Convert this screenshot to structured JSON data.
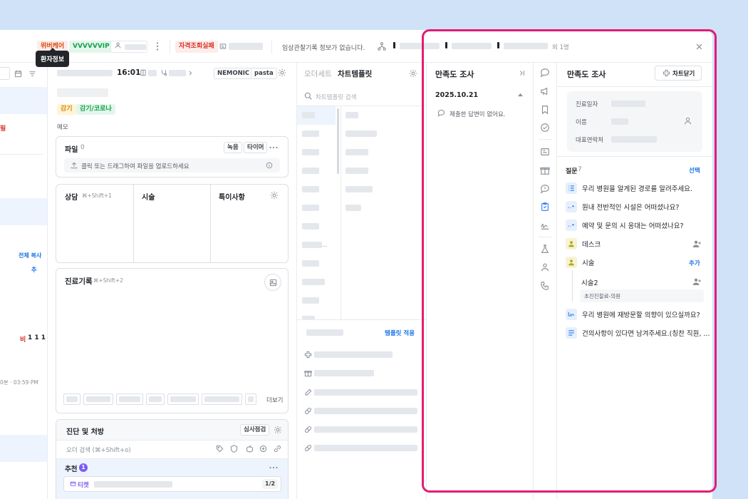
{
  "topbar": {
    "tag_care": "위버케어",
    "tag_vip": "VVVVVVIP",
    "tooltip": "환자정보",
    "tag_eligibility": "자격조회실패",
    "clinical_notice": "임상관찰기록 정보가 없습니다.",
    "extra_count": "외 1명"
  },
  "chart": {
    "time": "16:01",
    "tags": [
      "감기",
      "감기/코로나"
    ],
    "memo_label": "메모",
    "file_label": "파일",
    "file_count": "0",
    "btn_record": "녹음",
    "btn_timer": "타이머",
    "upload_hint": "클릭 또는 드래그하여 파일을 업로드하세요",
    "consult_label": "상담",
    "consult_shortcut": "⌘+Shift+1",
    "treatment_label": "시술",
    "special_label": "특이사항",
    "record_label": "진료기록",
    "record_shortcut": "⌘+Shift+2",
    "more_label": "더보기",
    "diagnosis_label": "진단 및 처방",
    "btn_audit": "심사점검",
    "order_search": "오더 검색 (⌘+Shift+o)",
    "recommend_label": "추천",
    "recommend_count": "1",
    "ticket_label": "티켓",
    "ticket_page": "1/2"
  },
  "left_col": {
    "copy_all": "전체 복사",
    "add": "추",
    "amount": "1 1 1",
    "non_label": "비",
    "time_range": "0분 · 03:59 PM",
    "red_text": "필"
  },
  "template": {
    "tab_orderset": "오더세트",
    "tab_chart": "차트템플릿",
    "search_placeholder": "차트템플릿 검색",
    "apply": "템플릿 적용",
    "dots": "..."
  },
  "badges": {
    "nemonic": "NEMONIC",
    "pasta": "pasta"
  },
  "survey_list": {
    "title": "만족도 조사",
    "date": "2025.10.21",
    "empty": "제출한 답변이 없어요."
  },
  "survey_detail": {
    "title": "만족도 조사",
    "close_chart": "차트닫기",
    "field_date": "진료일자",
    "field_name": "이름",
    "field_phone": "대표연락처",
    "questions_label": "질문",
    "questions_count": "7",
    "select": "선택",
    "add": "추가",
    "sub_badge": "초진진찰료-의원",
    "questions": [
      "우리 병원을 알게된 경로를 알려주세요.",
      "원내 전반적인 시설은 어떠셨나요?",
      "예약 및 문의 시 응대는 어떠셨나요?",
      "데스크",
      "시술",
      "시술2",
      "우리 병원에 재방문할 의향이 있으실까요?",
      "건의사항이 있다면 남겨주세요.(칭찬 직원, ..."
    ]
  },
  "colors": {
    "accent": "#1a73e8",
    "highlight_border": "#e11d74",
    "page_bg": "#cfe2f8"
  }
}
